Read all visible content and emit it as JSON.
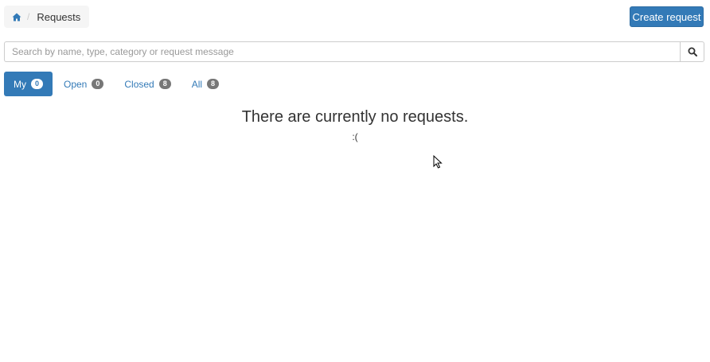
{
  "breadcrumb": {
    "home_icon": "home-icon",
    "separator": "/",
    "current": "Requests"
  },
  "header": {
    "create_label": "Create request"
  },
  "search": {
    "placeholder": "Search by name, type, category or request message",
    "value": "",
    "button_icon": "search-icon"
  },
  "tabs": [
    {
      "label": "My",
      "count": "0",
      "active": true
    },
    {
      "label": "Open",
      "count": "0",
      "active": false
    },
    {
      "label": "Closed",
      "count": "8",
      "active": false
    },
    {
      "label": "All",
      "count": "8",
      "active": false
    }
  ],
  "empty_state": {
    "title": "There are currently no requests.",
    "face": ":("
  },
  "colors": {
    "primary": "#337ab7",
    "badge": "#777777",
    "breadcrumb_bg": "#f5f5f5"
  }
}
